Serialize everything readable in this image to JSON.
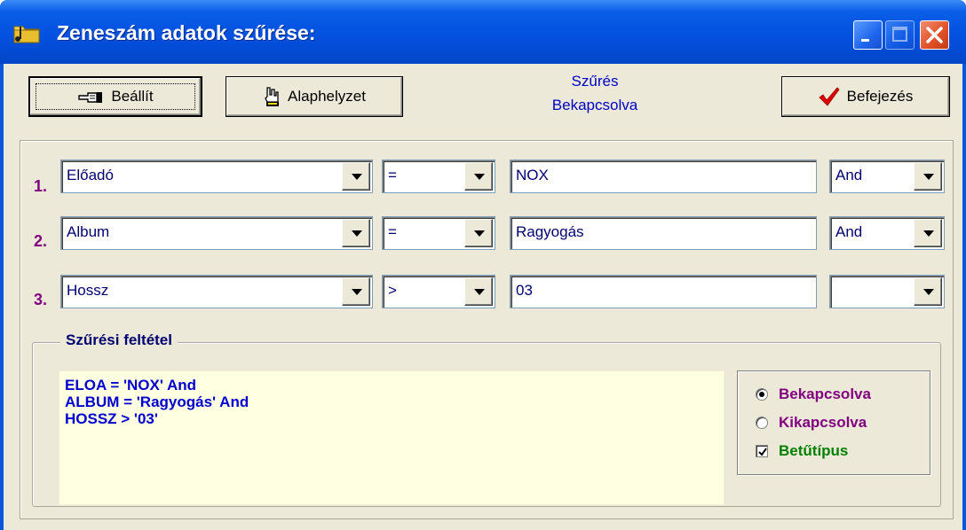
{
  "window": {
    "title": "Zeneszám adatok szűrése:",
    "controls": [
      "minimize",
      "maximize",
      "close"
    ]
  },
  "toolbar": {
    "beallit_label": "Beállít",
    "alaphelyzet_label": "Alaphelyzet",
    "befejezes_label": "Befejezés",
    "status_line1": "Szűrés",
    "status_line2": "Bekapcsolva"
  },
  "filters": [
    {
      "num": "1.",
      "field": "Előadó",
      "operator": "=",
      "value": "NOX",
      "logic": "And"
    },
    {
      "num": "2.",
      "field": "Album",
      "operator": "=",
      "value": "Ragyogás",
      "logic": "And"
    },
    {
      "num": "3.",
      "field": "Hossz",
      "operator": ">",
      "value": "03",
      "logic": ""
    }
  ],
  "condition": {
    "title": "Szűrési feltétel",
    "lines": [
      "ELOA = 'NOX' And",
      "ALBUM = 'Ragyogás' And",
      "HOSSZ > '03'"
    ]
  },
  "options": {
    "on_label": "Bekapcsolva",
    "off_label": "Kikapcsolva",
    "font_label": "Betűtípus",
    "selected": "Bekapcsolva",
    "font_checked": true,
    "on_color": "#800080",
    "off_color": "#800080",
    "font_color": "#008000"
  }
}
